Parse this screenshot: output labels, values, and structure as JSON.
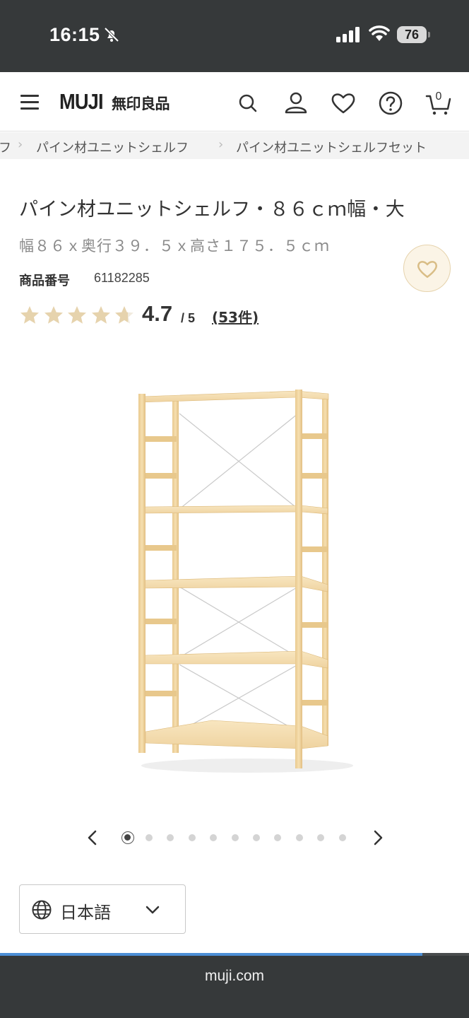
{
  "status_bar": {
    "time": "16:15",
    "battery": "76"
  },
  "header": {
    "logo_en": "MUJI",
    "logo_jp": "無印良品",
    "icons": [
      "menu-icon",
      "search-icon",
      "user-icon",
      "heart-icon",
      "help-icon",
      "cart-icon"
    ],
    "cart_count": "0"
  },
  "breadcrumb": {
    "items": [
      "フ",
      "パイン材ユニットシェルフ",
      "パイン材ユニットシェルフセット"
    ]
  },
  "product": {
    "title": "パイン材ユニットシェルフ・８６ｃｍ幅・大",
    "dimensions": "幅８６ｘ奥行３９．５ｘ高さ１７５．５ｃｍ",
    "code_label": "商品番号",
    "code_value": "61182285",
    "rating_value": "4.7",
    "rating_max": "/ 5",
    "rating_stars": 4.7,
    "review_count": "53件"
  },
  "carousel": {
    "total": 11,
    "active_index": 0
  },
  "language": {
    "selected": "日本語"
  },
  "browser": {
    "url": "muji.com",
    "load_progress": 0.9
  },
  "colors": {
    "status_bg": "#36393a",
    "star": "#e6d3ad",
    "fav_bg": "#fbf4e6",
    "progress": "#4d8fd6"
  }
}
